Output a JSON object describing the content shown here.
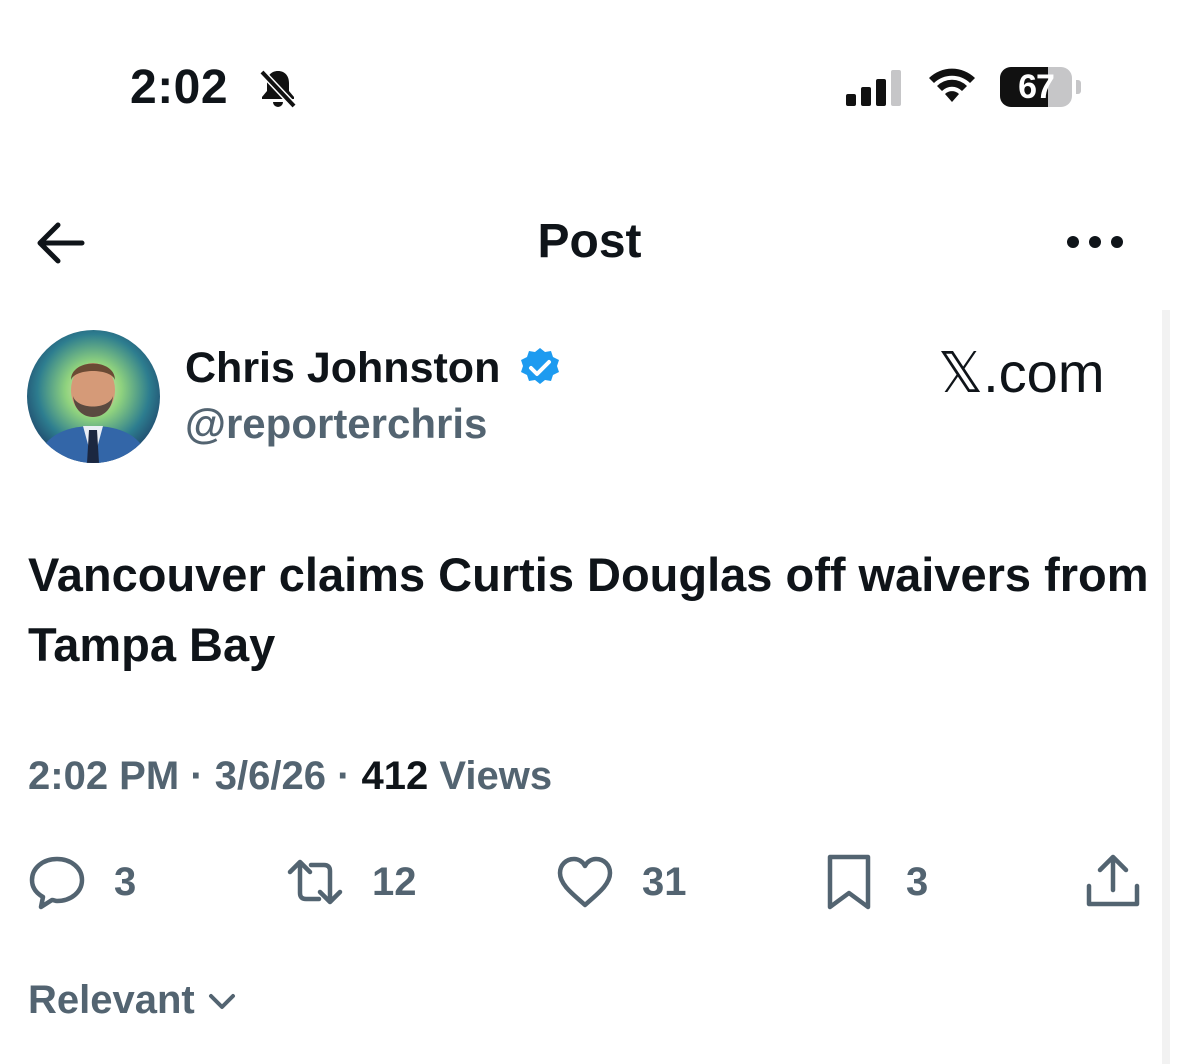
{
  "status_bar": {
    "time": "2:02",
    "battery_level": "67",
    "battery_fraction": 0.67
  },
  "nav": {
    "title": "Post"
  },
  "author": {
    "name": "Chris Johnston",
    "handle": "@reporterchris",
    "verified": true,
    "verified_color": "#1d9bf0"
  },
  "watermark": "𝕏.com",
  "post": {
    "text": "Vancouver claims Curtis Douglas off waivers from Tampa Bay",
    "time": "2:02 PM",
    "date": "3/6/26",
    "separator": "·",
    "views_count": "412",
    "views_label": "Views"
  },
  "actions": {
    "replies": "3",
    "reposts": "12",
    "likes": "31",
    "bookmarks": "3"
  },
  "sort": {
    "label": "Relevant"
  },
  "icons": [
    "bell-slash-icon",
    "signal-icon",
    "wifi-icon",
    "battery-icon",
    "back-arrow-icon",
    "more-icon",
    "verified-icon",
    "reply-icon",
    "repost-icon",
    "like-icon",
    "bookmark-icon",
    "share-icon",
    "chevron-down-icon"
  ]
}
